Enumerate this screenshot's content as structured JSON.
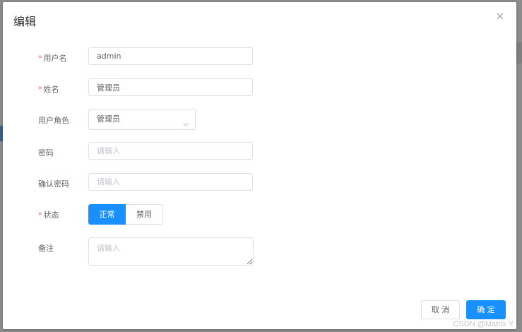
{
  "dialog": {
    "title": "编辑",
    "fields": {
      "username": {
        "label": "用户名",
        "value": "admin",
        "required": "*"
      },
      "name": {
        "label": "姓名",
        "value": "管理员",
        "required": "*"
      },
      "role": {
        "label": "用户角色",
        "value": "管理员"
      },
      "password": {
        "label": "密码",
        "placeholder": "请输入"
      },
      "confirm_password": {
        "label": "确认密码",
        "placeholder": "请输入"
      },
      "status": {
        "label": "状态",
        "required": "*",
        "options": [
          "正常",
          "禁用"
        ],
        "selected": "正常"
      },
      "remark": {
        "label": "备注",
        "placeholder": "请输入"
      }
    },
    "buttons": {
      "cancel": "取 消",
      "ok": "确 定"
    }
  },
  "watermark": "CSDN @Matrix Y",
  "colors": {
    "primary": "#1890ff",
    "required": "#f56c6c",
    "border": "#dcdfe6"
  },
  "icons": {
    "close": "close-icon",
    "dropdown": "chevron-down-icon"
  }
}
